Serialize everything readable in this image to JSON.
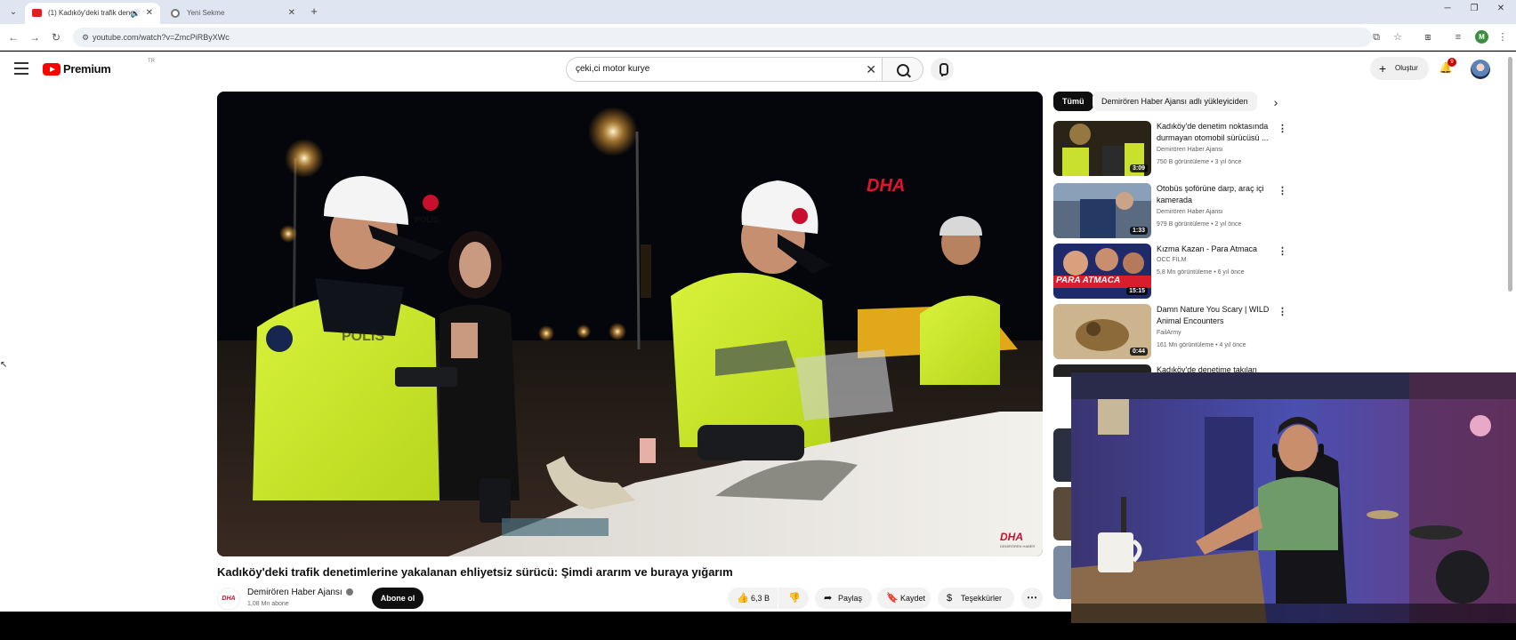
{
  "browser": {
    "tabs": [
      {
        "title": "(1) Kadıköy'deki trafik dene"
      },
      {
        "title": "Yeni Sekme"
      }
    ],
    "url": "youtube.com/watch?v=ZmcPiRByXWc",
    "profile_initial": "M"
  },
  "youtube": {
    "logo_text": "Premium",
    "country_code": "TR",
    "search_query": "çeki,ci motor kurye",
    "create_label": "Oluştur",
    "notification_count": "9"
  },
  "video": {
    "watermark": "DHA",
    "corner_logo": "DHA",
    "corner_logo_sub": "DEMİRÖREN HABER",
    "title": "Kadıköy'deki trafik denetimlerine yakalanan ehliyetsiz sürücü: Şimdi ararım ve buraya yığarım",
    "channel": "Demirören Haber Ajansı",
    "channel_avatar": "DHA",
    "subscribers": "1,08 Mn abone",
    "subscribe_label": "Abone ol",
    "likes": "6,3 B",
    "share_label": "Paylaş",
    "save_label": "Kaydet",
    "thanks_label": "Teşekkürler",
    "vest_text": "POLİS",
    "cap_text": "POLİS"
  },
  "sidebar": {
    "chips": [
      "Tümü",
      "Demirören Haber Ajansı adlı yükleyiciden"
    ],
    "recommendations": [
      {
        "title": "Kadıköy'de denetim noktasında durmayan otomobil sürücüsü ...",
        "channel": "Demirören Haber Ajansı",
        "meta": "750 B görüntüleme • 3 yıl önce",
        "duration": "3:09"
      },
      {
        "title": "Otobüs şoförüne darp, araç içi kamerada",
        "channel": "Demirören Haber Ajansı",
        "meta": "979 B görüntüleme • 2 yıl önce",
        "duration": "1:33"
      },
      {
        "title": "Kızma Kazan - Para Atmaca",
        "channel": "OCC FİLM",
        "meta": "5,8 Mn görüntüleme • 6 yıl önce",
        "duration": "15:15",
        "thumb_text": "PARA ATMACA"
      },
      {
        "title": "Damn Nature You Scary | WILD Animal Encounters",
        "channel": "FailArmy",
        "meta": "161 Mn görüntüleme • 4 yıl önce",
        "duration": "0:44"
      },
      {
        "title": "Kadıköy'de denetime takılan"
      }
    ]
  }
}
